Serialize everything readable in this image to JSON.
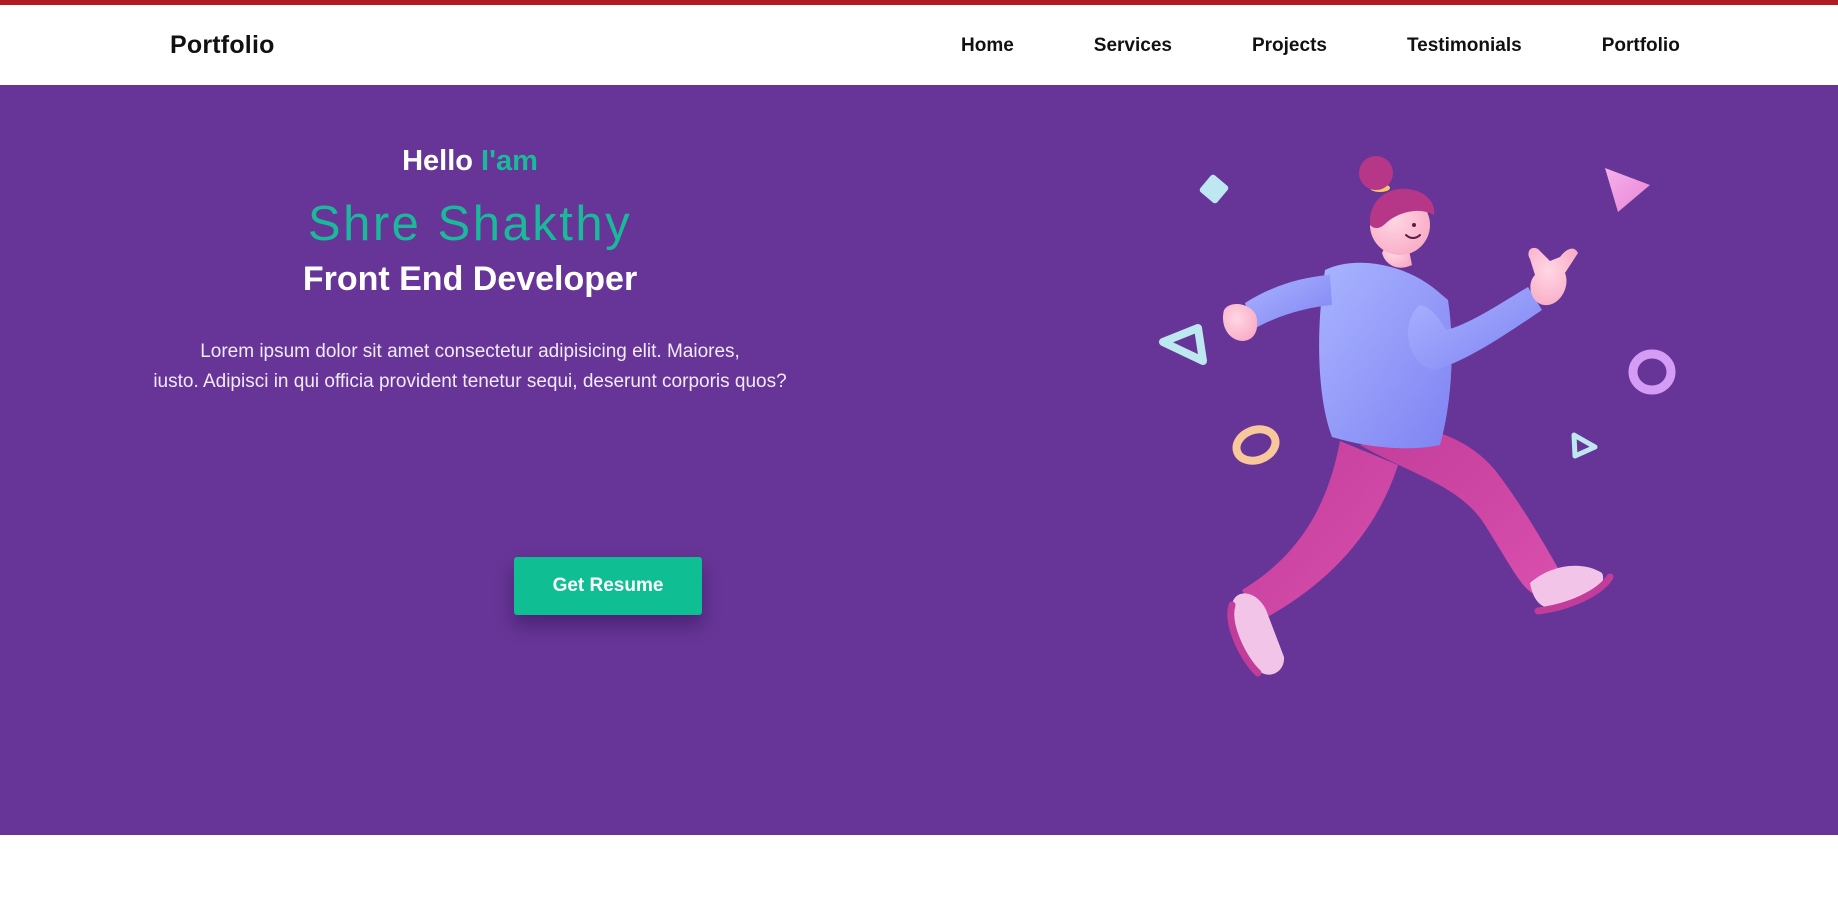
{
  "navbar": {
    "brand": "Portfolio",
    "links": [
      "Home",
      "Services",
      "Projects",
      "Testimonials",
      "Portfolio"
    ]
  },
  "hero": {
    "greeting": "Hello",
    "greeting_accent": "I'am",
    "name": "Shre Shakthy",
    "role": "Front End Developer",
    "bio_line1": "Lorem ipsum dolor sit amet consectetur adipisicing elit. Maiores,",
    "bio_line2": "iusto. Adipisci in qui officia provident tenetur sequi, deserunt corporis quos?",
    "button_label": "Get Resume"
  },
  "colors": {
    "top_bar": "#b01c24",
    "hero_background": "#673597",
    "accent": "#19b99a",
    "button": "#0fbf93"
  },
  "icons": {
    "hero_illustration": "running-person-illustration"
  }
}
